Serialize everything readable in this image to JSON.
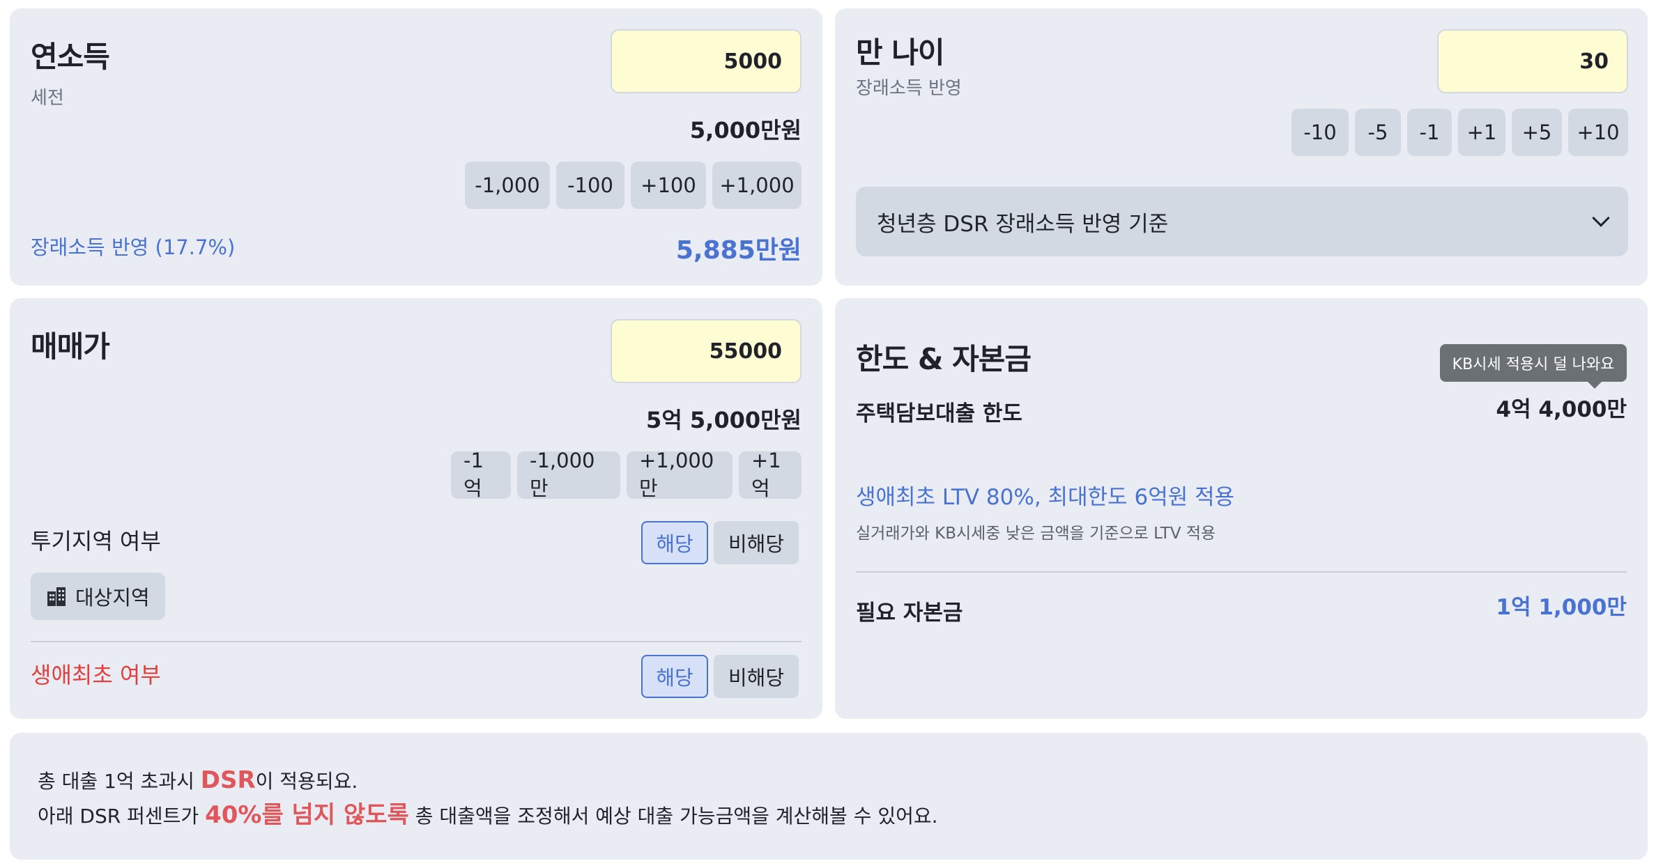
{
  "income": {
    "title": "연소득",
    "subtitle": "세전",
    "input_value": "5000",
    "formatted": "5,000만원",
    "steps": [
      "-1,000",
      "-100",
      "+100",
      "+1,000"
    ],
    "future_label": "장래소득 반영 (17.7%)",
    "future_value": "5,885만원"
  },
  "age": {
    "title": "만 나이",
    "subtitle": "장래소득 반영",
    "input_value": "30",
    "steps": [
      "-10",
      "-5",
      "-1",
      "+1",
      "+5",
      "+10"
    ],
    "dropdown_value": "청년층 DSR 장래소득 반영 기준"
  },
  "price": {
    "title": "매매가",
    "input_value": "55000",
    "formatted": "5억 5,000만원",
    "steps": [
      "-1억",
      "-1,000만",
      "+1,000만",
      "+1억"
    ],
    "speculative": {
      "label": "투기지역 여부",
      "yes": "해당",
      "no": "비해당",
      "chip_label": "대상지역",
      "chip_icon": "building-icon"
    },
    "first_time": {
      "label": "생애최초 여부",
      "yes": "해당",
      "no": "비해당",
      "label_color": "#e0403f"
    }
  },
  "limit": {
    "title": "한도 & 자본금",
    "tooltip": "KB시세 적용시 덜 나와요",
    "loan_label": "주택담보대출 한도",
    "loan_value": "4억 4,000만",
    "ltv_text": "생애최초 LTV 80%, 최대한도 6억원 적용",
    "ltv_sub": "실거래가와 KB시세중 낮은 금액을 기준으로 LTV 적용",
    "capital_label": "필요 자본금",
    "capital_value": "1억 1,000만"
  },
  "note": {
    "line1_pre": "총 대출 1억 초과시 ",
    "line1_hl": "DSR",
    "line1_post": "이 적용되요.",
    "line2_pre": "아래 DSR 퍼센트가 ",
    "line2_hl": "40%를 넘지 않도록",
    "line2_post": " 총 대출액을 조정해서 예상 대출 가능금액을 계산해볼 수 있어요."
  },
  "colors": {
    "accent_blue": "#4a72d0",
    "accent_red": "#e0575b",
    "card_bg": "#e9edf3",
    "input_bg": "#fefcd3"
  }
}
